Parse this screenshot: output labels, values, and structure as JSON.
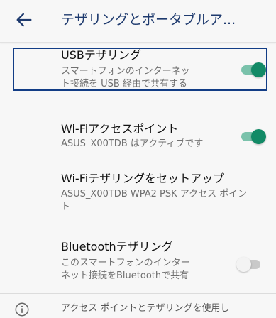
{
  "header": {
    "title": "テザリングとポータブルア..."
  },
  "items": [
    {
      "title": "USBテザリング",
      "subtitle_line1": "スマートフォンのインターネッ",
      "subtitle_line2": "ト接続を USB 経由で共有する",
      "toggle": "on"
    },
    {
      "title": "Wi-Fiアクセスポイント",
      "subtitle_line1": "ASUS_X00TDB はアクティブです",
      "toggle": "on"
    },
    {
      "title": "Wi-Fiテザリングをセットアップ",
      "subtitle_line1": "ASUS_X00TDB WPA2 PSK アクセス ポイン",
      "subtitle_line2": "ト"
    },
    {
      "title": "Bluetoothテザリング",
      "subtitle_line1": "このスマートフォンのインター",
      "subtitle_line2": "ネット接続をBluetoothで共有",
      "toggle": "off"
    }
  ],
  "footer": {
    "info_text": "アクセス ポイントとテザリングを使用し"
  },
  "colors": {
    "accent": "#128a66",
    "accent_track": "#7ac2ab",
    "title_color": "#1e3a6e",
    "highlight_border": "#123d86"
  }
}
